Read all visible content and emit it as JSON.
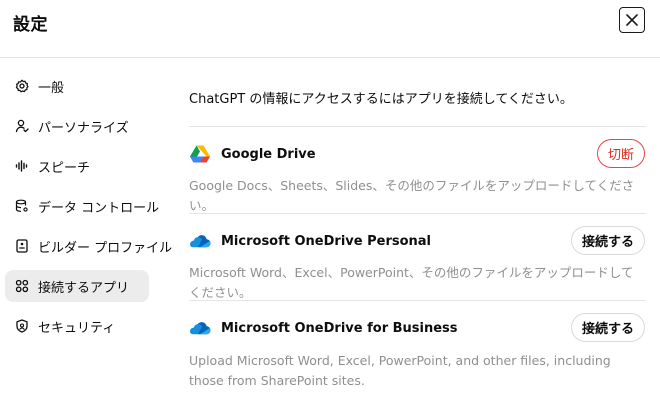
{
  "header": {
    "title": "設定"
  },
  "sidebar": {
    "items": [
      {
        "label": "一般",
        "icon": "gear-icon",
        "active": false
      },
      {
        "label": "パーソナライズ",
        "icon": "person-icon",
        "active": false
      },
      {
        "label": "スピーチ",
        "icon": "waveform-icon",
        "active": false
      },
      {
        "label": "データ コントロール",
        "icon": "database-icon",
        "active": false
      },
      {
        "label": "ビルダー プロファイル",
        "icon": "id-card-icon",
        "active": false
      },
      {
        "label": "接続するアプリ",
        "icon": "apps-grid-icon",
        "active": true
      },
      {
        "label": "セキュリティ",
        "icon": "shield-icon",
        "active": false
      }
    ]
  },
  "main": {
    "intro": "ChatGPT の情報にアクセスするにはアプリを接続してください。",
    "apps": [
      {
        "name": "Google Drive",
        "button": "切断",
        "description": "Google Docs、Sheets、Slides、その他のファイルをアップロードしてください。"
      },
      {
        "name": "Microsoft OneDrive Personal",
        "button": "接続する",
        "description": "Microsoft Word、Excel、PowerPoint、その他のファイルをアップロードしてください。"
      },
      {
        "name": "Microsoft OneDrive for Business",
        "button": "接続する",
        "description": "Upload Microsoft Word, Excel, PowerPoint, and other files, including those from SharePoint sites."
      }
    ]
  },
  "colors": {
    "disconnect": "#d92d20",
    "active_bg": "#ececec",
    "muted_text": "#8f8f8f"
  }
}
